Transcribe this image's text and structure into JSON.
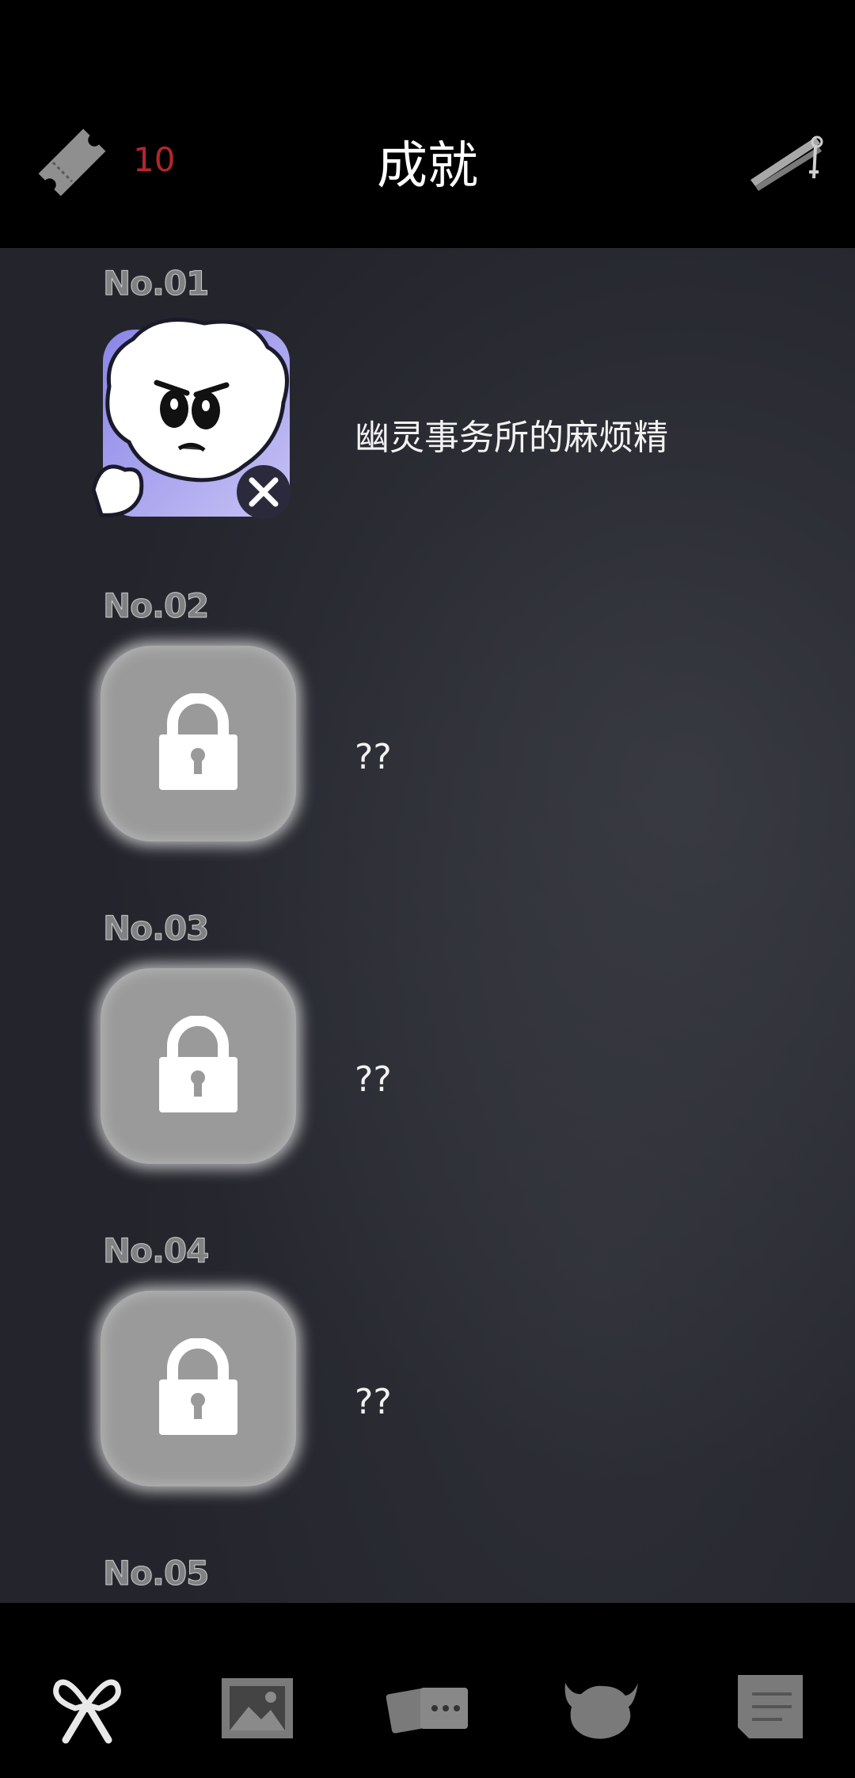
{
  "header": {
    "title": "成就",
    "ticket_count": "10",
    "ticket_icon": "ticket-icon",
    "tool_icon": "tweezers-icon"
  },
  "achievements": [
    {
      "number": "No.01",
      "name": "幽灵事务所的麻烦精",
      "unlocked": true
    },
    {
      "number": "No.02",
      "name": "??",
      "unlocked": false
    },
    {
      "number": "No.03",
      "name": "??",
      "unlocked": false
    },
    {
      "number": "No.04",
      "name": "??",
      "unlocked": false
    },
    {
      "number": "No.05",
      "name": "",
      "unlocked": false
    }
  ],
  "nav": {
    "items": [
      "ribbon-icon",
      "photos-icon",
      "cards-icon",
      "ox-icon",
      "notes-icon"
    ],
    "active": "ribbon-icon"
  },
  "colors": {
    "ticket_count": "#b3262a",
    "lock_tile": "#9a9a9a",
    "content_bg": "#24252c"
  }
}
